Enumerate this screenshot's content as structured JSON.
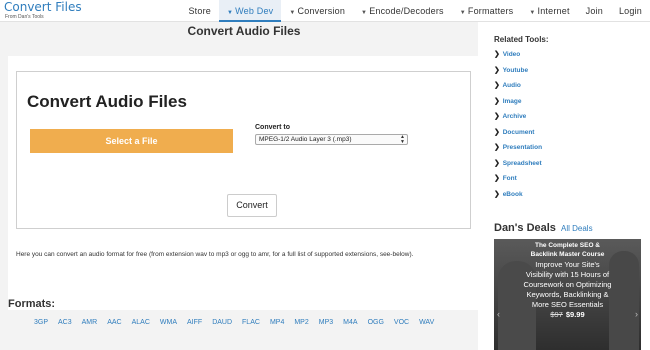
{
  "header": {
    "logo_title": "Convert Files",
    "logo_subtitle": "From Dan's Tools",
    "nav": [
      {
        "label": "Store",
        "dropdown": false,
        "active": false
      },
      {
        "label": "Web Dev",
        "dropdown": true,
        "active": true
      },
      {
        "label": "Conversion",
        "dropdown": true,
        "active": false
      },
      {
        "label": "Encode/Decoders",
        "dropdown": true,
        "active": false
      },
      {
        "label": "Formatters",
        "dropdown": true,
        "active": false
      },
      {
        "label": "Internet",
        "dropdown": true,
        "active": false
      },
      {
        "label": "Join",
        "dropdown": false,
        "active": false
      },
      {
        "label": "Login",
        "dropdown": false,
        "active": false
      }
    ]
  },
  "main": {
    "page_title": "Convert Audio Files",
    "form_title": "Convert Audio Files",
    "select_file_label": "Select a File",
    "convert_to_label": "Convert to",
    "selected_format": "MPEG-1/2 Audio Layer 3 (.mp3)",
    "convert_button": "Convert",
    "description": "Here you can convert an audio format for free (from extension wav to mp3 or ogg to amr, for a full list of supported extensions, see-below).",
    "formats_title": "Formats:",
    "formats": [
      "3GP",
      "AC3",
      "AMR",
      "AAC",
      "ALAC",
      "WMA",
      "AIFF",
      "DAUD",
      "FLAC",
      "MP4",
      "MP2",
      "MP3",
      "M4A",
      "OGG",
      "VOC",
      "WAV"
    ]
  },
  "sidebar": {
    "related_title": "Related Tools:",
    "related_tools": [
      "Video",
      "Youtube",
      "Audio",
      "Image",
      "Archive",
      "Document",
      "Presentation",
      "Spreadsheet",
      "Font",
      "eBook"
    ],
    "deals_title": "Dan's Deals",
    "deals_link": "All Deals",
    "promo": {
      "headline_line1": "The Complete SEO &",
      "headline_line2": "Backlink Master Course",
      "sub_line1": "Improve Your Site's",
      "sub_line2": "Visibility with 15 Hours of",
      "sub_line3": "Coursework on Optimizing",
      "sub_line4": "Keywords, Backlinking &",
      "sub_line5": "More SEO Essentials",
      "old_price": "$97",
      "price": "$9.99"
    }
  },
  "colors": {
    "accent": "#2f7dbd",
    "select_button": "#f0ad4e",
    "main_bg": "#f3f3f3"
  }
}
